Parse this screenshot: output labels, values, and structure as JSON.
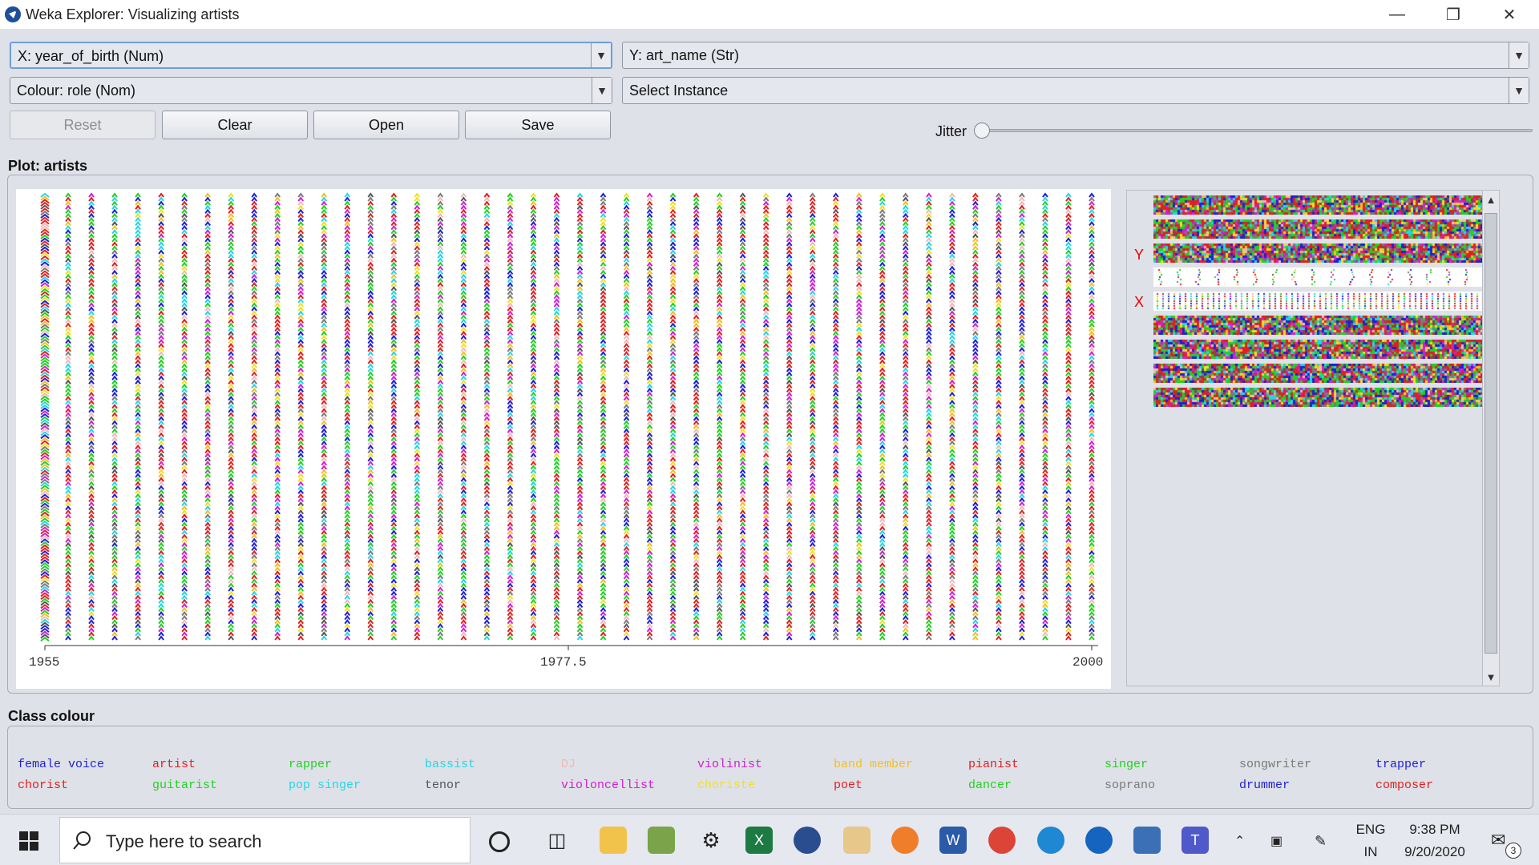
{
  "window": {
    "title": "Weka Explorer: Visualizing artists"
  },
  "controls": {
    "x_axis": "X: year_of_birth (Num)",
    "y_axis": "Y: art_name (Str)",
    "colour": "Colour: role (Nom)",
    "select_instance": "Select Instance",
    "buttons": {
      "reset": "Reset",
      "clear": "Clear",
      "open": "Open",
      "save": "Save"
    },
    "jitter_label": "Jitter",
    "jitter_value": 0
  },
  "plot": {
    "label": "Plot: artists",
    "x_ticks": [
      "1955",
      "1977.5",
      "2000"
    ],
    "matrix_markers": [
      "Y",
      "X"
    ]
  },
  "legend": {
    "label": "Class colour",
    "items": [
      {
        "name": "female voice",
        "color": "#1f1fd6"
      },
      {
        "name": "artist",
        "color": "#e02020"
      },
      {
        "name": "rapper",
        "color": "#22d022"
      },
      {
        "name": "bassist",
        "color": "#22d6e6"
      },
      {
        "name": "DJ",
        "color": "#f2b8b8"
      },
      {
        "name": "violinist",
        "color": "#d020d0"
      },
      {
        "name": "band member",
        "color": "#f2c020"
      },
      {
        "name": "pianist",
        "color": "#e02020"
      },
      {
        "name": "singer",
        "color": "#22d022"
      },
      {
        "name": "songwriter",
        "color": "#7a7a7a"
      },
      {
        "name": "trapper",
        "color": "#1f1fd6"
      },
      {
        "name": "chorist",
        "color": "#e02020"
      },
      {
        "name": "guitarist",
        "color": "#22d022"
      },
      {
        "name": "pop singer",
        "color": "#22d6e6"
      },
      {
        "name": "tenor",
        "color": "#555555"
      },
      {
        "name": "violoncellist",
        "color": "#d020d0"
      },
      {
        "name": "choriste",
        "color": "#f2e020"
      },
      {
        "name": "poet",
        "color": "#e02020"
      },
      {
        "name": "dancer",
        "color": "#22d022"
      },
      {
        "name": "soprano",
        "color": "#7a7a7a"
      },
      {
        "name": "drummer",
        "color": "#1f1fd6"
      },
      {
        "name": "composer",
        "color": "#e02020"
      }
    ]
  },
  "taskbar": {
    "search_placeholder": "Type here to search",
    "language": "ENG",
    "region": "IN",
    "time": "9:38 PM",
    "date": "9/20/2020",
    "notification_count": "3",
    "apps": [
      "task-view",
      "file-explorer",
      "photo-app",
      "settings",
      "excel",
      "weka",
      "paint",
      "jupyter",
      "word",
      "chrome",
      "edge",
      "teamviewer",
      "network-app",
      "teams"
    ]
  }
}
